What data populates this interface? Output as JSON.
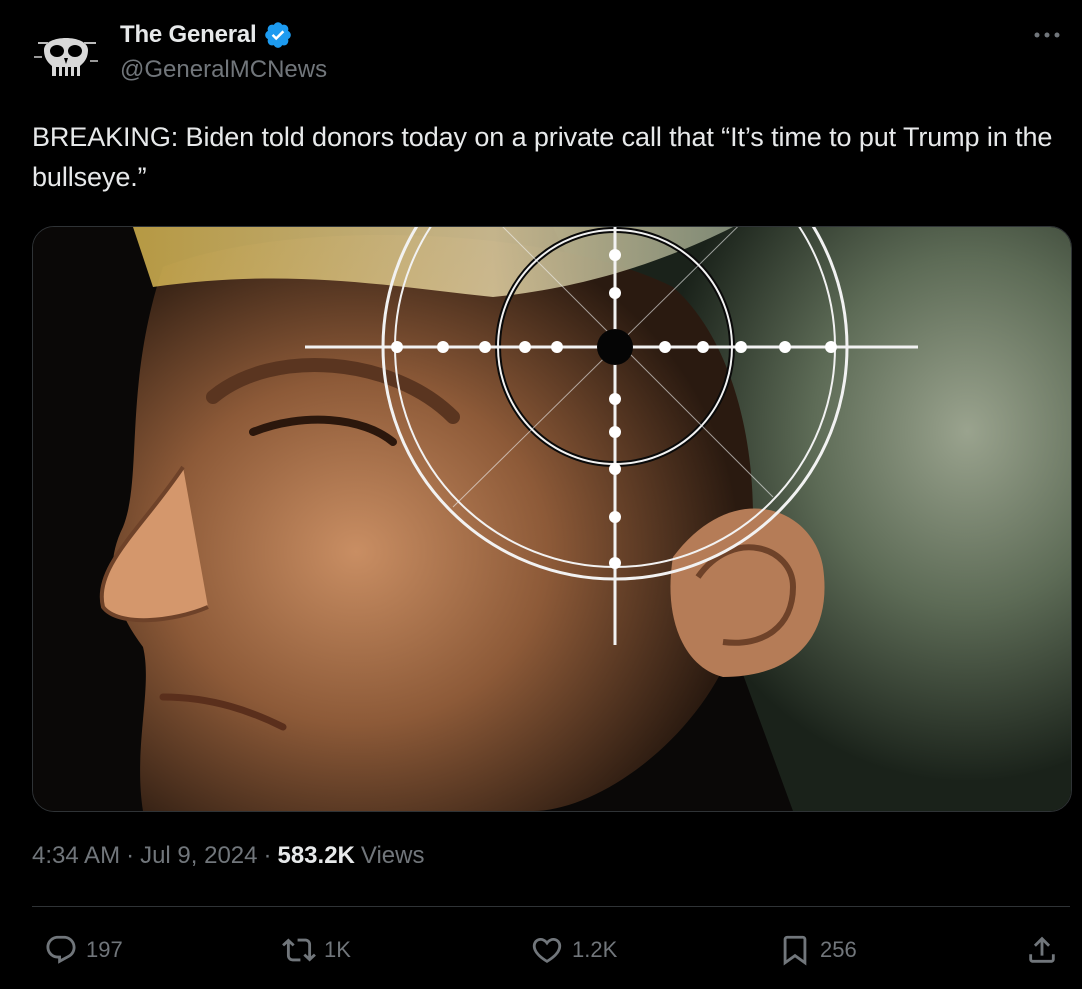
{
  "author": {
    "display_name": "The General",
    "handle": "@GeneralMCNews",
    "verified_icon": "verified-badge-icon"
  },
  "tweet": {
    "text": "BREAKING: Biden told donors today on a private call that “It’s time to put Trump in the bullseye.”",
    "media_icon": "photo-with-crosshair"
  },
  "meta": {
    "time": "4:34 AM",
    "date": "Jul 9, 2024",
    "views_count": "583.2K",
    "views_label": "Views",
    "separator": "·"
  },
  "actions": {
    "replies": "197",
    "reposts": "1K",
    "likes": "1.2K",
    "bookmarks": "256"
  },
  "colors": {
    "background": "#000000",
    "text_primary": "#e7e9ea",
    "text_secondary": "#71767b",
    "verified": "#1d9bf0",
    "divider": "#2f3336"
  }
}
